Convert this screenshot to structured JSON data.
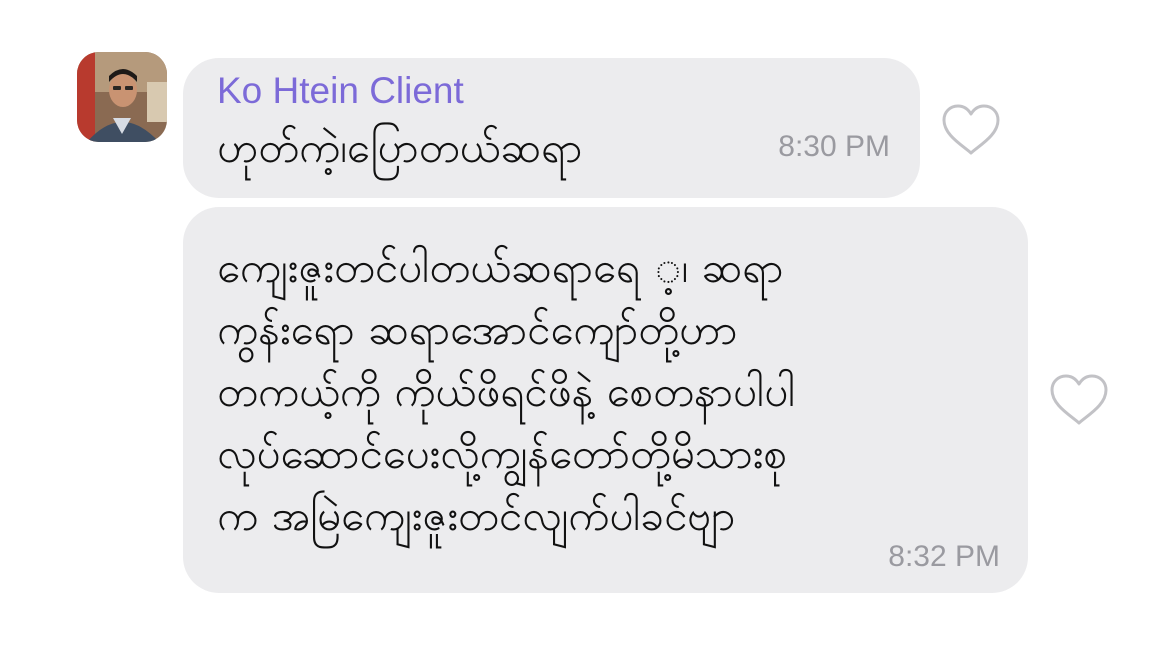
{
  "messages": [
    {
      "sender": "Ko Htein Client",
      "text": "ဟုတ်ကဲ့၊ပြောတယ်ဆရာ",
      "time": "8:30 PM",
      "like_icon": "heart-outline-icon"
    },
    {
      "lines": [
        "ကျေးဇူးတင်ပါတယ်ဆရာရေ ့၊ ဆရာ",
        "ကွန်းရော ဆရာအောင်ကျော်တို့ဟာ",
        "တကယ့်ကို ကိုယ်ဖိရင်ဖိနဲ့ စေတနာပါပါ",
        "လုပ်ဆောင်ပေးလို့ကျွန်တော်တို့မိသားစု",
        "က အမြဲကျေးဇူးတင်လျက်ပါခင်ဗျာ"
      ],
      "time": "8:32 PM",
      "like_icon": "heart-outline-icon"
    }
  ],
  "colors": {
    "bubble": "#ececee",
    "sender_name": "#7c6ad8",
    "timestamp": "#9a9aa0",
    "heart_outline": "#c2c2c6"
  }
}
